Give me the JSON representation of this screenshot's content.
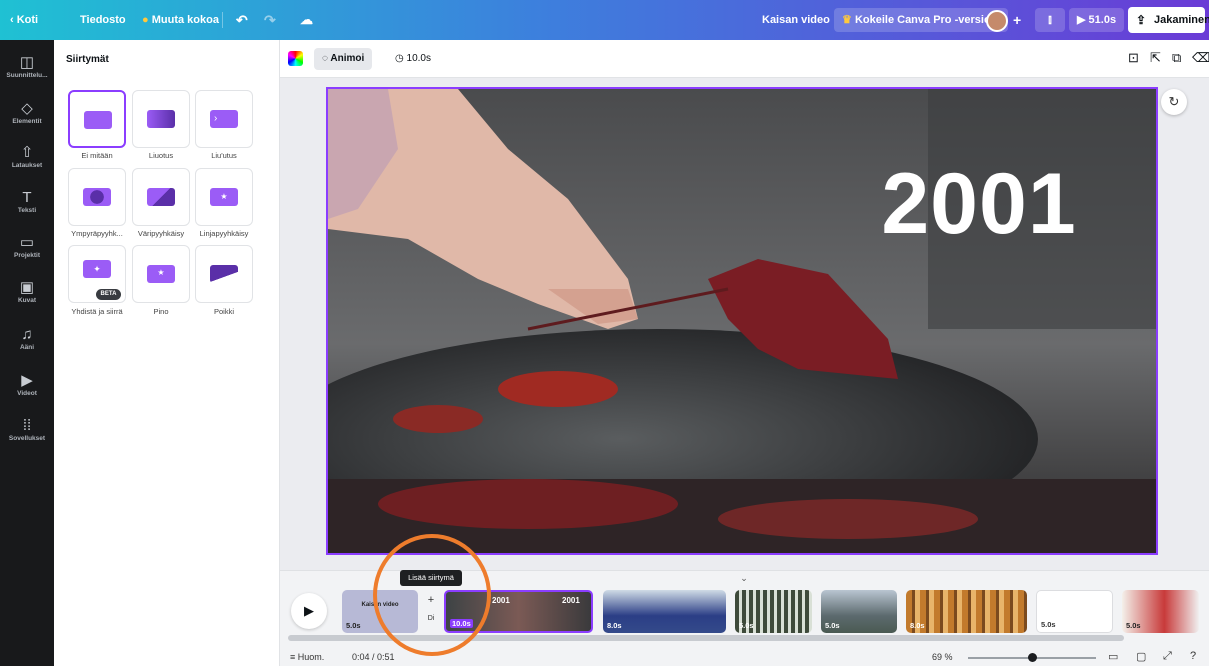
{
  "topbar": {
    "home": "Koti",
    "file": "Tiedosto",
    "resize": "Muuta kokoa",
    "folder": "Kaisan video",
    "pro": "Kokeile Canva Pro -versiota",
    "duration": "51.0s",
    "share": "Jakaminen"
  },
  "rail": [
    {
      "label": "Suunnittelu...",
      "icon": "layout-icon"
    },
    {
      "label": "Elementit",
      "icon": "shapes-icon"
    },
    {
      "label": "Lataukset",
      "icon": "cloud-upload-icon"
    },
    {
      "label": "Teksti",
      "icon": "text-icon"
    },
    {
      "label": "Projektit",
      "icon": "folder-icon"
    },
    {
      "label": "Kuvat",
      "icon": "image-icon"
    },
    {
      "label": "Ääni",
      "icon": "music-icon"
    },
    {
      "label": "Videot",
      "icon": "video-icon"
    },
    {
      "label": "Sovellukset",
      "icon": "apps-icon"
    }
  ],
  "panel": {
    "title": "Siirtymät",
    "badge": "BETA",
    "items": [
      "Ei mitään",
      "Liuotus",
      "Liu'utus",
      "Ympyräpyyhk...",
      "Väripyyhkäisy",
      "Linjapyyhkäisy",
      "Yhdistä ja siirrä",
      "Pino",
      "Poikki"
    ]
  },
  "toolbar": {
    "animate": "Animoi",
    "duration": "10.0s"
  },
  "canvas": {
    "year": "2001"
  },
  "timeline": {
    "tooltip": "Lisää siirtymä",
    "first_clip_text": "Kaisan video",
    "clips": [
      "5.0s",
      "10.0s",
      "8.0s",
      "5.0s",
      "5.0s",
      "8.0s",
      "5.0s",
      "5.0s"
    ],
    "plus_partial": "Di"
  },
  "footer": {
    "notes": "Huom.",
    "time": "0:04 / 0:51",
    "zoom": "69 %"
  },
  "colors": {
    "accent": "#8b3dff",
    "highlight_circle": "#ee7c2c"
  }
}
